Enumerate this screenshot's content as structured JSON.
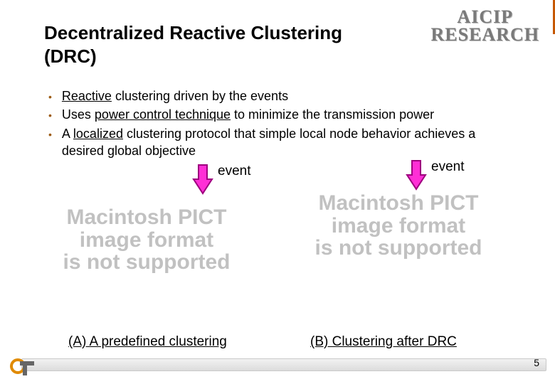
{
  "header": {
    "logo_line1": "AICIP",
    "logo_line2": "RESEARCH"
  },
  "title": "Decentralized Reactive Clustering (DRC)",
  "bullets": [
    {
      "pre": "",
      "u": "Reactive",
      "post": " clustering driven by the events"
    },
    {
      "pre": "Uses ",
      "u": "power control technique",
      "post": " to minimize the transmission power"
    },
    {
      "pre": "A ",
      "u": "localized",
      "post": " clustering protocol that simple local node behavior achieves a desired global objective"
    }
  ],
  "events": {
    "left_label": "event",
    "right_label": "event"
  },
  "placeholders": {
    "left": "Macintosh PICT\nimage format\nis not supported",
    "right": "Macintosh PICT\nimage format\nis not supported"
  },
  "captions": {
    "a": "(A) A predefined clustering",
    "b": "(B) Clustering after DRC"
  },
  "page_number": "5",
  "colors": {
    "arrow_fill": "#ff2fd6",
    "arrow_stroke": "#9e007e",
    "bullet_mark": "#9c5a10"
  }
}
